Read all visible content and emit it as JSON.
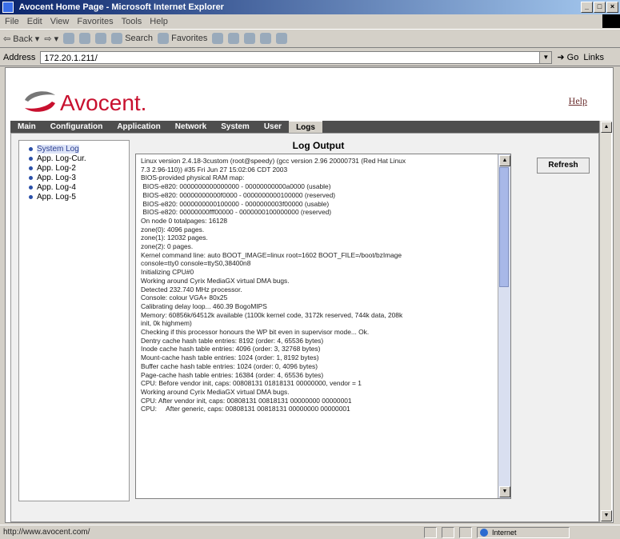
{
  "window": {
    "title": "Avocent Home Page - Microsoft Internet Explorer",
    "buttons": [
      "_",
      "□",
      "×"
    ]
  },
  "menubar": [
    "File",
    "Edit",
    "View",
    "Favorites",
    "Tools",
    "Help"
  ],
  "toolbar": {
    "back_label": "Back",
    "search_label": "Search",
    "favorites_label": "Favorites"
  },
  "address": {
    "label": "Address",
    "value": "172.20.1.211/",
    "go_label": "Go",
    "links_label": "Links"
  },
  "page": {
    "brand": "Avocent.",
    "help_label": "Help",
    "nav_tabs": [
      "Main",
      "Configuration",
      "Application",
      "Network",
      "System",
      "User",
      "Logs"
    ],
    "active_tab": "Logs",
    "sidebar_items": [
      "System Log",
      "App. Log-Cur.",
      "App. Log-2",
      "App. Log-3",
      "App. Log-4",
      "App. Log-5"
    ],
    "active_sidebar": "System Log",
    "log_title": "Log Output",
    "refresh_label": "Refresh",
    "log_lines": [
      "Linux version 2.4.18-3custom (root@speedy) (gcc version 2.96 20000731 (Red Hat Linux",
      "7.3 2.96-110)) #35 Fri Jun 27 15:02:06 CDT 2003",
      "BIOS-provided physical RAM map:",
      " BIOS-e820: 0000000000000000 - 00000000000a0000 (usable)",
      " BIOS-e820: 00000000000f0000 - 0000000000100000 (reserved)",
      " BIOS-e820: 0000000000100000 - 0000000003f00000 (usable)",
      " BIOS-e820: 00000000fff00000 - 0000000100000000 (reserved)",
      "On node 0 totalpages: 16128",
      "zone(0): 4096 pages.",
      "zone(1): 12032 pages.",
      "zone(2): 0 pages.",
      "Kernel command line: auto BOOT_IMAGE=linux root=1602 BOOT_FILE=/boot/bzImage",
      "console=tty0 console=ttyS0,38400n8",
      "Initializing CPU#0",
      "Working around Cyrix MediaGX virtual DMA bugs.",
      "Detected 232.740 MHz processor.",
      "Console: colour VGA+ 80x25",
      "Calibrating delay loop... 460.39 BogoMIPS",
      "Memory: 60856k/64512k available (1100k kernel code, 3172k reserved, 744k data, 208k",
      "init, 0k highmem)",
      "Checking if this processor honours the WP bit even in supervisor mode... Ok.",
      "Dentry cache hash table entries: 8192 (order: 4, 65536 bytes)",
      "Inode cache hash table entries: 4096 (order: 3, 32768 bytes)",
      "Mount-cache hash table entries: 1024 (order: 1, 8192 bytes)",
      "Buffer cache hash table entries: 1024 (order: 0, 4096 bytes)",
      "Page-cache hash table entries: 16384 (order: 4, 65536 bytes)",
      "CPU: Before vendor init, caps: 00808131 01818131 00000000, vendor = 1",
      "Working around Cyrix MediaGX virtual DMA bugs.",
      "CPU: After vendor init, caps: 00808131 00818131 00000000 00000001",
      "CPU:     After generic, caps: 00808131 00818131 00000000 00000001"
    ]
  },
  "status": {
    "url": "http://www.avocent.com/",
    "zone": "Internet"
  }
}
